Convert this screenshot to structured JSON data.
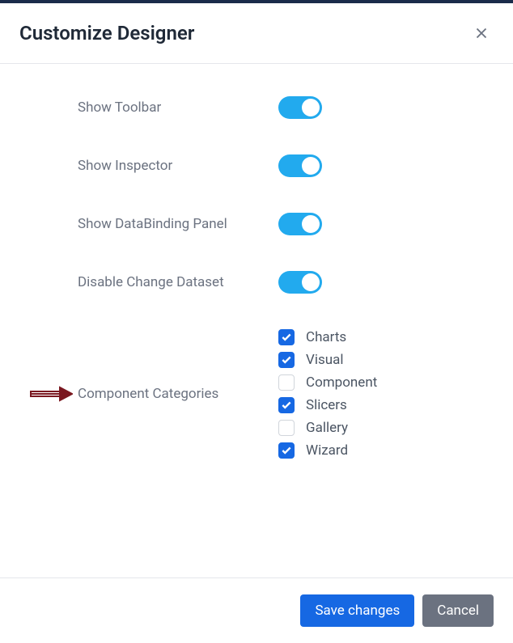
{
  "dialog": {
    "title": "Customize Designer",
    "settings": [
      {
        "label": "Show Toolbar",
        "on": true
      },
      {
        "label": "Show Inspector",
        "on": true
      },
      {
        "label": "Show DataBinding Panel",
        "on": true
      },
      {
        "label": "Disable Change Dataset",
        "on": true
      }
    ],
    "componentCategories": {
      "label": "Component Categories",
      "items": [
        {
          "label": "Charts",
          "checked": true
        },
        {
          "label": "Visual",
          "checked": true
        },
        {
          "label": "Component",
          "checked": false
        },
        {
          "label": "Slicers",
          "checked": true
        },
        {
          "label": "Gallery",
          "checked": false
        },
        {
          "label": "Wizard",
          "checked": true
        }
      ]
    },
    "footer": {
      "save": "Save changes",
      "cancel": "Cancel"
    }
  }
}
